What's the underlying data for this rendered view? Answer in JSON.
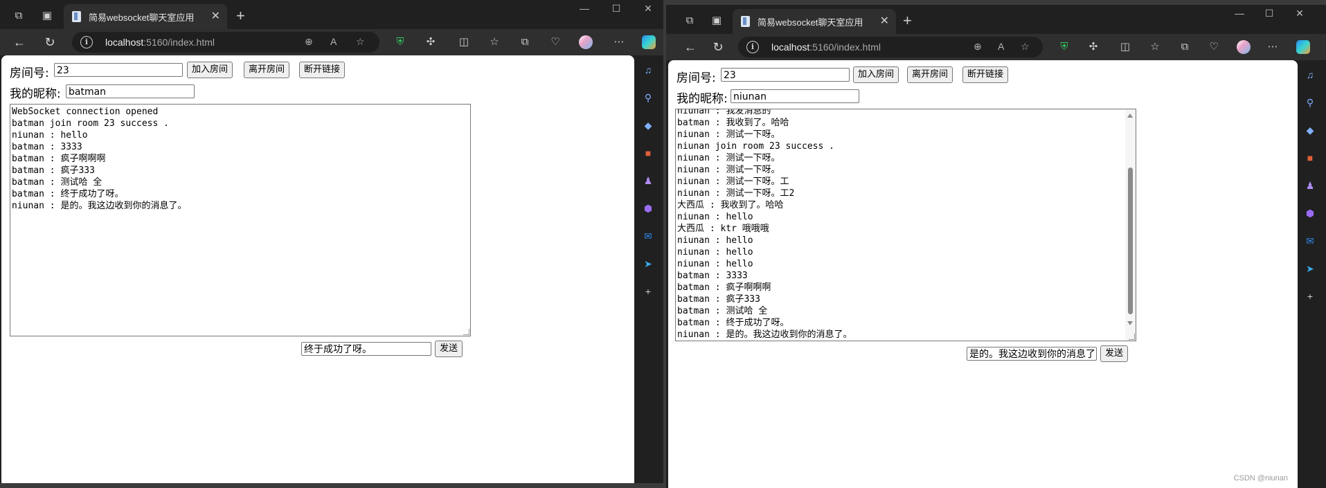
{
  "browser": {
    "tab_title": "简易websocket聊天室应用",
    "url_host": "localhost",
    "url_path": ":5160/index.html",
    "controls": {
      "minimize": "—",
      "maximize": "☐",
      "close": "✕",
      "new_tab": "+"
    }
  },
  "left_window": {
    "room_label": "房间号:",
    "room_value": "23",
    "join_button": "加入房间",
    "leave_button": "离开房间",
    "disconnect_button": "断开链接",
    "nickname_label": "我的昵称:",
    "nickname_value": "batman",
    "messages": [
      "WebSocket connection opened",
      "batman join room 23 success .",
      "niunan : hello",
      "batman : 3333",
      "batman : 疯子啊啊啊",
      "batman : 疯子333",
      "batman : 测试哈 全",
      "batman : 终于成功了呀。",
      "niunan : 是的。我这边收到你的消息了。"
    ],
    "message_input": "终于成功了呀。",
    "send_button": "发送"
  },
  "right_window": {
    "room_label": "房间号:",
    "room_value": "23",
    "join_button": "加入房间",
    "leave_button": "离开房间",
    "disconnect_button": "断开链接",
    "nickname_label": "我的昵称:",
    "nickname_value": "niunan",
    "messages": [
      "niunan : 我发消息的",
      "batman : 我收到了。哈哈",
      "niunan : 测试一下呀。",
      "niunan join room 23 success .",
      "niunan : 测试一下呀。",
      "niunan : 测试一下呀。",
      "niunan : 测试一下呀。工",
      "niunan : 测试一下呀。工2",
      "大西瓜 : 我收到了。哈哈",
      "niunan : hello",
      "大西瓜 : ktr 哦哦哦",
      "niunan : hello",
      "niunan : hello",
      "niunan : hello",
      "batman : 3333",
      "batman : 疯子啊啊啊",
      "batman : 疯子333",
      "batman : 测试哈 全",
      "batman : 终于成功了呀。",
      "niunan : 是的。我这边收到你的消息了。"
    ],
    "message_input": "是的。我这边收到你的消息了",
    "send_button": "发送"
  },
  "watermark": "CSDN @niunan",
  "colors": {
    "frame": "#202020",
    "toolbar": "#2f2f2f",
    "accent_shield": "#35c35f",
    "sidebar_icon": "#7fb1ff"
  }
}
